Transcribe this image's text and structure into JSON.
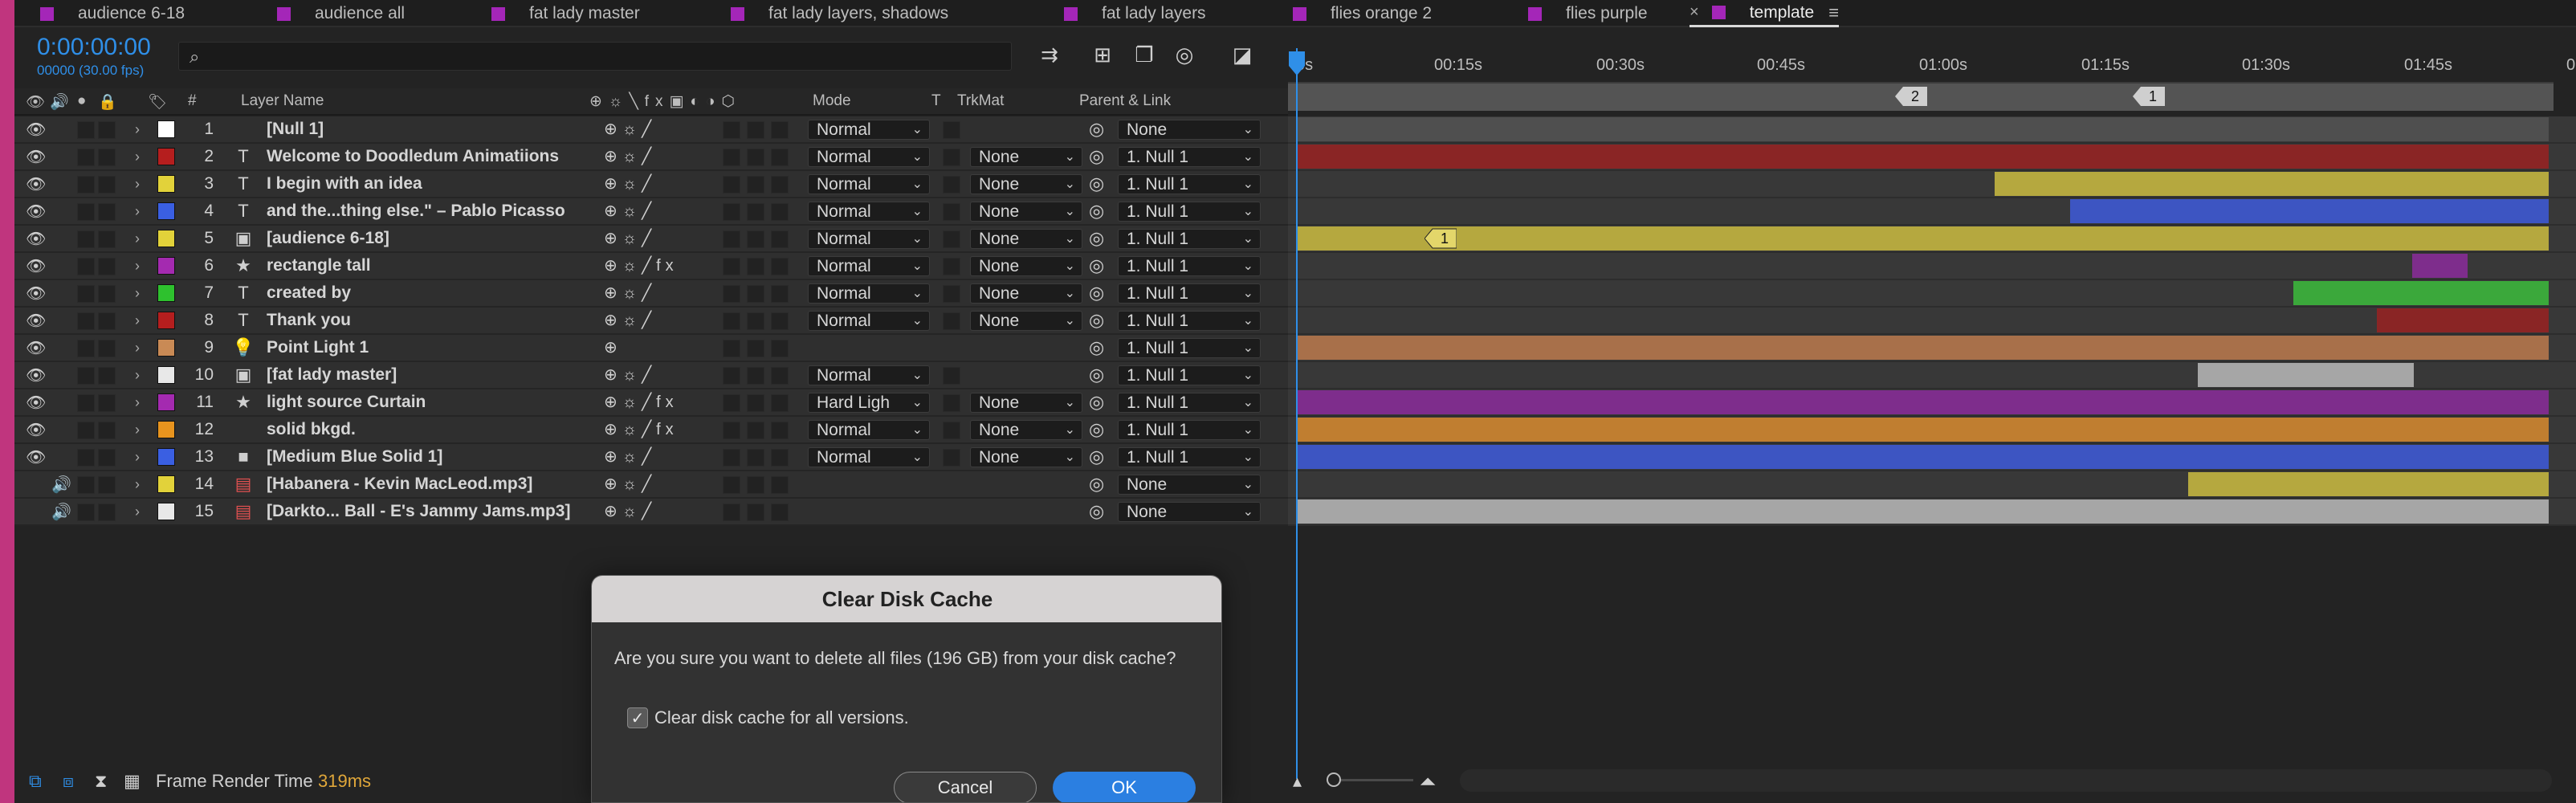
{
  "tabs": [
    {
      "label": "audience 6-18",
      "active": false
    },
    {
      "label": "audience all",
      "active": false
    },
    {
      "label": "fat lady master",
      "active": false
    },
    {
      "label": "fat lady layers, shadows",
      "active": false
    },
    {
      "label": "fat lady layers",
      "active": false
    },
    {
      "label": "flies  orange 2",
      "active": false
    },
    {
      "label": "flies  purple",
      "active": false
    },
    {
      "label": "template",
      "active": true
    }
  ],
  "tab_close_icon": "×",
  "tab_menu_icon": "≡",
  "header": {
    "timecode": "0:00:00:00",
    "frames": "00000 (30.00 fps)",
    "search_placeholder": ""
  },
  "columns": {
    "num": "#",
    "layer_name": "Layer Name",
    "mode": "Mode",
    "t": "T",
    "trkmat": "TrkMat",
    "parent": "Parent & Link"
  },
  "ruler": {
    "ticks": [
      "0s",
      "00:15s",
      "00:30s",
      "00:45s",
      "01:00s",
      "01:15s",
      "01:30s",
      "01:45s",
      "0"
    ],
    "markers": [
      "2",
      "1"
    ]
  },
  "layers": [
    {
      "num": "1",
      "name": "[Null 1]",
      "type": "none",
      "color": "#ffffff",
      "mode": "Normal",
      "trkmat": "",
      "parent": "None",
      "fx": false,
      "eye": true,
      "audio": false
    },
    {
      "num": "2",
      "name": "Welcome to Doodledum Animatiions",
      "type": "T",
      "color": "#b51e1e",
      "mode": "Normal",
      "trkmat": "None",
      "parent": "1. Null 1",
      "fx": false,
      "eye": true,
      "audio": false
    },
    {
      "num": "3",
      "name": "I begin with an idea",
      "type": "T",
      "color": "#e2d23a",
      "mode": "Normal",
      "trkmat": "None",
      "parent": "1. Null 1",
      "fx": false,
      "eye": true,
      "audio": false
    },
    {
      "num": "4",
      "name": "and the...thing else.\" – Pablo Picasso",
      "type": "T",
      "color": "#3a5fe2",
      "mode": "Normal",
      "trkmat": "None",
      "parent": "1. Null 1",
      "fx": false,
      "eye": true,
      "audio": false
    },
    {
      "num": "5",
      "name": "[audience 6-18]",
      "type": "comp",
      "color": "#e2d23a",
      "mode": "Normal",
      "trkmat": "None",
      "parent": "1. Null 1",
      "fx": false,
      "eye": true,
      "audio": false
    },
    {
      "num": "6",
      "name": "rectangle tall",
      "type": "star",
      "color": "#a42ab0",
      "mode": "Normal",
      "trkmat": "None",
      "parent": "1. Null 1",
      "fx": true,
      "eye": true,
      "audio": false
    },
    {
      "num": "7",
      "name": "created by",
      "type": "T",
      "color": "#2ec12e",
      "mode": "Normal",
      "trkmat": "None",
      "parent": "1. Null 1",
      "fx": false,
      "eye": true,
      "audio": false
    },
    {
      "num": "8",
      "name": "Thank you",
      "type": "T",
      "color": "#b51e1e",
      "mode": "Normal",
      "trkmat": "None",
      "parent": "1. Null 1",
      "fx": false,
      "eye": true,
      "audio": false
    },
    {
      "num": "9",
      "name": "Point Light 1",
      "type": "light",
      "color": "#c98a55",
      "mode": "",
      "trkmat": "",
      "parent": "1. Null 1",
      "fx": false,
      "eye": true,
      "audio": false
    },
    {
      "num": "10",
      "name": "[fat lady master]",
      "type": "comp",
      "color": "#e8e8e8",
      "mode": "Normal",
      "trkmat": "",
      "parent": "1. Null 1",
      "fx": false,
      "eye": true,
      "audio": false
    },
    {
      "num": "11",
      "name": "light source Curtain",
      "type": "star",
      "color": "#a42ab0",
      "mode": "Hard Ligh",
      "trkmat": "None",
      "parent": "1. Null 1",
      "fx": true,
      "eye": true,
      "audio": false
    },
    {
      "num": "12",
      "name": "solid bkgd.",
      "type": "none",
      "color": "#e8941e",
      "mode": "Normal",
      "trkmat": "None",
      "parent": "1. Null 1",
      "fx": true,
      "eye": true,
      "audio": false
    },
    {
      "num": "13",
      "name": "[Medium Blue Solid 1]",
      "type": "solid",
      "color": "#3a5fe2",
      "mode": "Normal",
      "trkmat": "None",
      "parent": "1. Null 1",
      "fx": false,
      "eye": true,
      "audio": false
    },
    {
      "num": "14",
      "name": "[Habanera - Kevin MacLeod.mp3]",
      "type": "audio",
      "color": "#e2d23a",
      "mode": "",
      "trkmat": "",
      "parent": "None",
      "fx": false,
      "eye": false,
      "audio": true
    },
    {
      "num": "15",
      "name": "[Darkto... Ball - E's Jammy Jams.mp3]",
      "type": "audio",
      "color": "#e8e8e8",
      "mode": "",
      "trkmat": "",
      "parent": "None",
      "fx": false,
      "eye": false,
      "audio": true
    }
  ],
  "timeline_bars": [
    {
      "color": "#4f4f4f",
      "start": 0.0,
      "end": 1.0
    },
    {
      "color": "#8a2525",
      "start": 0.0,
      "end": 1.0
    },
    {
      "color": "#b5a83f",
      "start": 0.558,
      "end": 1.0
    },
    {
      "color": "#3d55c2",
      "start": 0.618,
      "end": 1.0
    },
    {
      "color": "#b5a83f",
      "start": 0.0,
      "end": 1.0,
      "marker": "1"
    },
    {
      "color": "#7e2d8c",
      "start": 0.891,
      "end": 0.935
    },
    {
      "color": "#3ba83b",
      "start": 0.796,
      "end": 1.0
    },
    {
      "color": "#8a2525",
      "start": 0.863,
      "end": 1.0
    },
    {
      "color": "#a8704a",
      "start": 0.0,
      "end": 1.0
    },
    {
      "color": "#a6a6a6",
      "start": 0.72,
      "end": 0.892
    },
    {
      "color": "#7e2d8c",
      "start": 0.0,
      "end": 1.0
    },
    {
      "color": "#c07e30",
      "start": 0.0,
      "end": 1.0
    },
    {
      "color": "#3d55c2",
      "start": 0.0,
      "end": 1.0
    },
    {
      "color": "#b5a83f",
      "start": 0.712,
      "end": 1.0
    },
    {
      "color": "#a6a6a6",
      "start": 0.0,
      "end": 1.0
    }
  ],
  "bottom": {
    "frame_render_label": "Frame Render Time",
    "frame_render_value": "319ms"
  },
  "dialog": {
    "title": "Clear Disk Cache",
    "message": "Are you sure you want to delete all files (196 GB) from your disk cache?",
    "checkbox_label": "Clear disk cache for all versions.",
    "checkbox_checked": true,
    "cancel_label": "Cancel",
    "ok_label": "OK"
  }
}
